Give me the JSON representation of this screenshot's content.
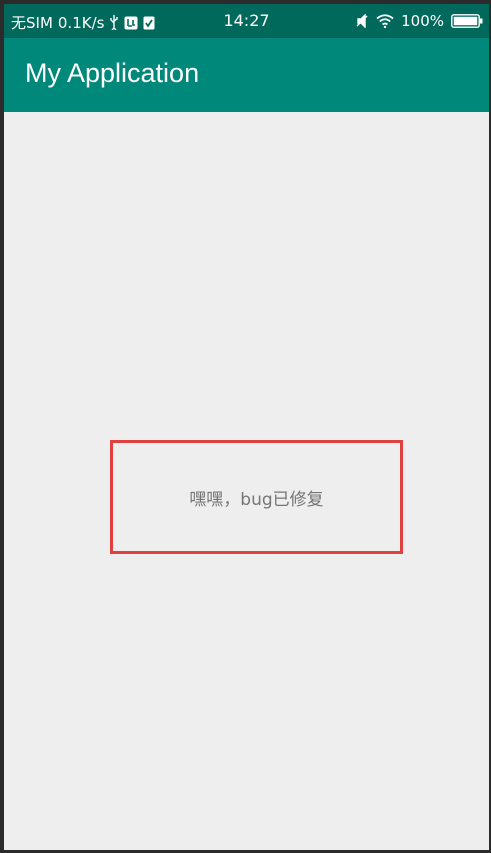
{
  "status_bar": {
    "carrier": "无SIM",
    "net_speed": "0.1K/s",
    "time": "14:27",
    "battery": "100%",
    "icons": [
      "usb-icon",
      "notification-icon",
      "check-icon",
      "mute-icon",
      "wifi-icon",
      "battery-icon"
    ]
  },
  "app_bar": {
    "title": "My Application",
    "color": "#00897b"
  },
  "content": {
    "message": "嘿嘿，bug已修复",
    "highlight_color": "#e0403e"
  }
}
